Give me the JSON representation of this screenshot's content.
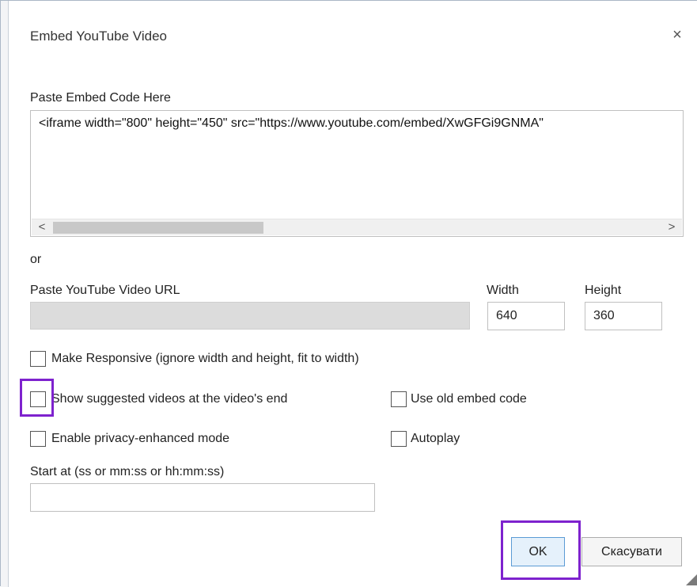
{
  "dialog": {
    "title": "Embed YouTube Video",
    "close_glyph": "×"
  },
  "embed": {
    "label": "Paste Embed Code Here",
    "value": "<iframe width=\"800\" height=\"450\" src=\"https://www.youtube.com/embed/XwGFGi9GNMA\"",
    "scroll_left": "<",
    "scroll_right": ">"
  },
  "or_text": "or",
  "url": {
    "label": "Paste YouTube Video URL",
    "value": ""
  },
  "width": {
    "label": "Width",
    "value": "640"
  },
  "height": {
    "label": "Height",
    "value": "360"
  },
  "options": {
    "responsive": {
      "label": "Make Responsive (ignore width and height, fit to width)",
      "checked": false
    },
    "suggested": {
      "label": "Show suggested videos at the video's end",
      "checked": false
    },
    "old_embed": {
      "label": "Use old embed code",
      "checked": false
    },
    "privacy": {
      "label": "Enable privacy-enhanced mode",
      "checked": false
    },
    "autoplay": {
      "label": "Autoplay",
      "checked": false
    }
  },
  "start": {
    "label": "Start at (ss or mm:ss or hh:mm:ss)",
    "value": ""
  },
  "buttons": {
    "ok": "OK",
    "cancel": "Скасувати"
  },
  "colors": {
    "highlight": "#7e22ce",
    "ok_border": "#5b9bd5",
    "disabled_input": "#dcdcdc"
  }
}
